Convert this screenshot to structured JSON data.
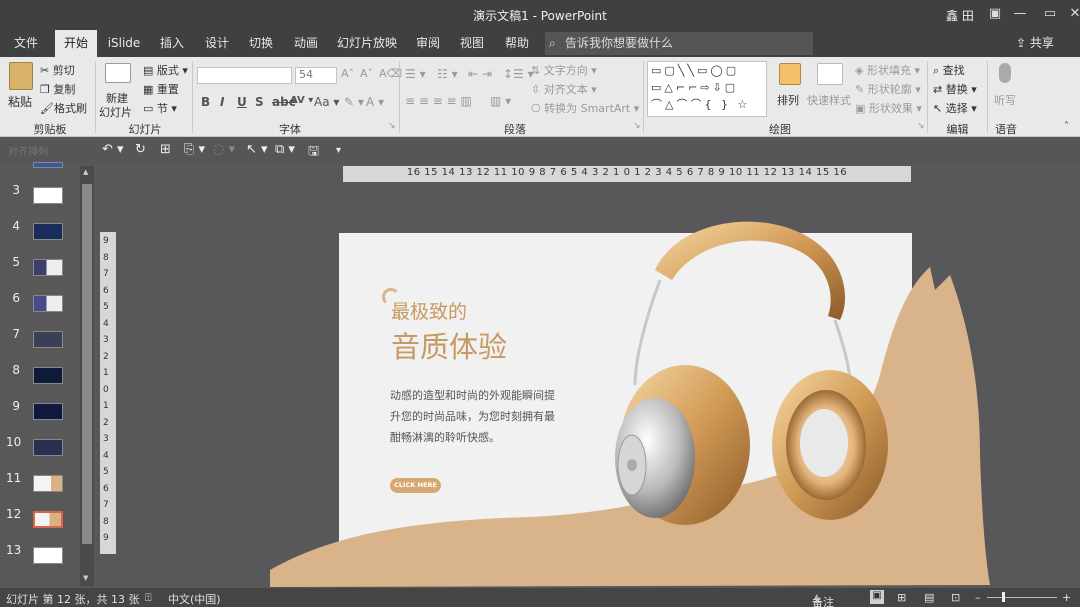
{
  "window": {
    "title": "演示文稿1  -  PowerPoint",
    "user": "鑫 田",
    "minimize": "—",
    "restore": "▭",
    "close": "✕"
  },
  "tabs": [
    "文件",
    "开始",
    "iSlide",
    "插入",
    "设计",
    "切换",
    "动画",
    "幻灯片放映",
    "审阅",
    "视图",
    "帮助"
  ],
  "active_tab": "开始",
  "tell_me": "告诉我你想要做什么",
  "share": "共享",
  "ribbon": {
    "clipboard": {
      "label": "剪贴板",
      "paste": "粘贴",
      "cut": "剪切",
      "copy": "复制",
      "format_painter": "格式刷"
    },
    "slides": {
      "label": "幻灯片",
      "new_slide_line1": "新建",
      "new_slide_line2": "幻灯片",
      "layout": "版式",
      "reset": "重置",
      "section": "节"
    },
    "font": {
      "label": "字体",
      "font_size": "54"
    },
    "paragraph": {
      "label": "段落",
      "text_direction": "文字方向",
      "align_text": "对齐文本",
      "smartart": "转换为 SmartArt"
    },
    "drawing": {
      "label": "绘图",
      "arrange": "排列",
      "quick_styles": "快速样式",
      "shape_fill": "形状填充",
      "shape_outline": "形状轮廓",
      "shape_effects": "形状效果"
    },
    "editing": {
      "label": "编辑",
      "find": "查找",
      "replace": "替换",
      "select": "选择"
    },
    "voice": {
      "label": "语音",
      "dictate": "听写"
    }
  },
  "quick_access": {
    "group_label": "对齐排列"
  },
  "thumbnails": [
    {
      "num": "3"
    },
    {
      "num": "4"
    },
    {
      "num": "5"
    },
    {
      "num": "6"
    },
    {
      "num": "7"
    },
    {
      "num": "8"
    },
    {
      "num": "9"
    },
    {
      "num": "10"
    },
    {
      "num": "11"
    },
    {
      "num": "12"
    },
    {
      "num": "13"
    }
  ],
  "ruler": {
    "horizontal": "16 15 14 13 12 11 10 9 8 7 6 5 4 3 2 1 0 1 2 3 4 5 6 7 8 9 10 11 12 13 14 15 16",
    "vertical": [
      "9",
      "8",
      "7",
      "6",
      "5",
      "4",
      "3",
      "2",
      "1",
      "0",
      "1",
      "2",
      "3",
      "4",
      "5",
      "6",
      "7",
      "8",
      "9"
    ]
  },
  "slide": {
    "headline_small": "最极致的",
    "headline_large": "音质体验",
    "body": "动感的造型和时尚的外观能瞬间提升您的时尚品味，为您时刻拥有最酣畅淋漓的聆听快感。",
    "cta": "CLICK HERE",
    "accent_color": "#c79a62"
  },
  "status": {
    "slide_info": "幻灯片 第 12 张，共 13 张",
    "language": "中文(中国)",
    "notes": "备注"
  }
}
